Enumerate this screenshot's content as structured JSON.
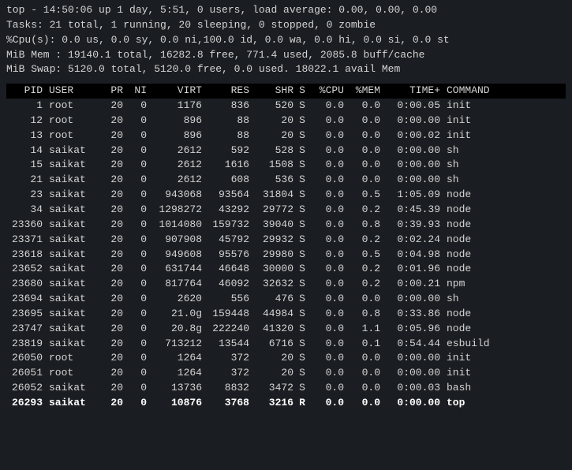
{
  "summary": {
    "line1": "top - 14:50:06 up 1 day,  5:51,  0 users,  load average: 0.00, 0.00, 0.00",
    "line2": "Tasks:  21 total,   1 running,  20 sleeping,   0 stopped,   0 zombie",
    "line3": "%Cpu(s):  0.0 us,  0.0 sy,  0.0 ni,100.0 id,  0.0 wa,  0.0 hi,  0.0 si,  0.0 st",
    "line4": "MiB Mem :  19140.1 total,  16282.8 free,    771.4 used,   2085.8 buff/cache",
    "line5": "MiB Swap:   5120.0 total,   5120.0 free,      0.0 used.  18022.1 avail Mem"
  },
  "headers": {
    "pid": "PID",
    "user": "USER",
    "pr": "PR",
    "ni": "NI",
    "virt": "VIRT",
    "res": "RES",
    "shr": "SHR",
    "s": "S",
    "cpu": "%CPU",
    "mem": "%MEM",
    "time": "TIME+",
    "command": "COMMAND"
  },
  "processes": [
    {
      "pid": "1",
      "user": "root",
      "pr": "20",
      "ni": "0",
      "virt": "1176",
      "res": "836",
      "shr": "520",
      "s": "S",
      "cpu": "0.0",
      "mem": "0.0",
      "time": "0:00.05",
      "command": "init",
      "running": false
    },
    {
      "pid": "12",
      "user": "root",
      "pr": "20",
      "ni": "0",
      "virt": "896",
      "res": "88",
      "shr": "20",
      "s": "S",
      "cpu": "0.0",
      "mem": "0.0",
      "time": "0:00.00",
      "command": "init",
      "running": false
    },
    {
      "pid": "13",
      "user": "root",
      "pr": "20",
      "ni": "0",
      "virt": "896",
      "res": "88",
      "shr": "20",
      "s": "S",
      "cpu": "0.0",
      "mem": "0.0",
      "time": "0:00.02",
      "command": "init",
      "running": false
    },
    {
      "pid": "14",
      "user": "saikat",
      "pr": "20",
      "ni": "0",
      "virt": "2612",
      "res": "592",
      "shr": "528",
      "s": "S",
      "cpu": "0.0",
      "mem": "0.0",
      "time": "0:00.00",
      "command": "sh",
      "running": false
    },
    {
      "pid": "15",
      "user": "saikat",
      "pr": "20",
      "ni": "0",
      "virt": "2612",
      "res": "1616",
      "shr": "1508",
      "s": "S",
      "cpu": "0.0",
      "mem": "0.0",
      "time": "0:00.00",
      "command": "sh",
      "running": false
    },
    {
      "pid": "21",
      "user": "saikat",
      "pr": "20",
      "ni": "0",
      "virt": "2612",
      "res": "608",
      "shr": "536",
      "s": "S",
      "cpu": "0.0",
      "mem": "0.0",
      "time": "0:00.00",
      "command": "sh",
      "running": false
    },
    {
      "pid": "23",
      "user": "saikat",
      "pr": "20",
      "ni": "0",
      "virt": "943068",
      "res": "93564",
      "shr": "31804",
      "s": "S",
      "cpu": "0.0",
      "mem": "0.5",
      "time": "1:05.09",
      "command": "node",
      "running": false
    },
    {
      "pid": "34",
      "user": "saikat",
      "pr": "20",
      "ni": "0",
      "virt": "1298272",
      "res": "43292",
      "shr": "29772",
      "s": "S",
      "cpu": "0.0",
      "mem": "0.2",
      "time": "0:45.39",
      "command": "node",
      "running": false
    },
    {
      "pid": "23360",
      "user": "saikat",
      "pr": "20",
      "ni": "0",
      "virt": "1014080",
      "res": "159732",
      "shr": "39040",
      "s": "S",
      "cpu": "0.0",
      "mem": "0.8",
      "time": "0:39.93",
      "command": "node",
      "running": false
    },
    {
      "pid": "23371",
      "user": "saikat",
      "pr": "20",
      "ni": "0",
      "virt": "907908",
      "res": "45792",
      "shr": "29932",
      "s": "S",
      "cpu": "0.0",
      "mem": "0.2",
      "time": "0:02.24",
      "command": "node",
      "running": false
    },
    {
      "pid": "23618",
      "user": "saikat",
      "pr": "20",
      "ni": "0",
      "virt": "949608",
      "res": "95576",
      "shr": "29980",
      "s": "S",
      "cpu": "0.0",
      "mem": "0.5",
      "time": "0:04.98",
      "command": "node",
      "running": false
    },
    {
      "pid": "23652",
      "user": "saikat",
      "pr": "20",
      "ni": "0",
      "virt": "631744",
      "res": "46648",
      "shr": "30000",
      "s": "S",
      "cpu": "0.0",
      "mem": "0.2",
      "time": "0:01.96",
      "command": "node",
      "running": false
    },
    {
      "pid": "23680",
      "user": "saikat",
      "pr": "20",
      "ni": "0",
      "virt": "817764",
      "res": "46092",
      "shr": "32632",
      "s": "S",
      "cpu": "0.0",
      "mem": "0.2",
      "time": "0:00.21",
      "command": "npm",
      "running": false
    },
    {
      "pid": "23694",
      "user": "saikat",
      "pr": "20",
      "ni": "0",
      "virt": "2620",
      "res": "556",
      "shr": "476",
      "s": "S",
      "cpu": "0.0",
      "mem": "0.0",
      "time": "0:00.00",
      "command": "sh",
      "running": false
    },
    {
      "pid": "23695",
      "user": "saikat",
      "pr": "20",
      "ni": "0",
      "virt": "21.0g",
      "res": "159448",
      "shr": "44984",
      "s": "S",
      "cpu": "0.0",
      "mem": "0.8",
      "time": "0:33.86",
      "command": "node",
      "running": false
    },
    {
      "pid": "23747",
      "user": "saikat",
      "pr": "20",
      "ni": "0",
      "virt": "20.8g",
      "res": "222240",
      "shr": "41320",
      "s": "S",
      "cpu": "0.0",
      "mem": "1.1",
      "time": "0:05.96",
      "command": "node",
      "running": false
    },
    {
      "pid": "23819",
      "user": "saikat",
      "pr": "20",
      "ni": "0",
      "virt": "713212",
      "res": "13544",
      "shr": "6716",
      "s": "S",
      "cpu": "0.0",
      "mem": "0.1",
      "time": "0:54.44",
      "command": "esbuild",
      "running": false
    },
    {
      "pid": "26050",
      "user": "root",
      "pr": "20",
      "ni": "0",
      "virt": "1264",
      "res": "372",
      "shr": "20",
      "s": "S",
      "cpu": "0.0",
      "mem": "0.0",
      "time": "0:00.00",
      "command": "init",
      "running": false
    },
    {
      "pid": "26051",
      "user": "root",
      "pr": "20",
      "ni": "0",
      "virt": "1264",
      "res": "372",
      "shr": "20",
      "s": "S",
      "cpu": "0.0",
      "mem": "0.0",
      "time": "0:00.00",
      "command": "init",
      "running": false
    },
    {
      "pid": "26052",
      "user": "saikat",
      "pr": "20",
      "ni": "0",
      "virt": "13736",
      "res": "8832",
      "shr": "3472",
      "s": "S",
      "cpu": "0.0",
      "mem": "0.0",
      "time": "0:00.03",
      "command": "bash",
      "running": false
    },
    {
      "pid": "26293",
      "user": "saikat",
      "pr": "20",
      "ni": "0",
      "virt": "10876",
      "res": "3768",
      "shr": "3216",
      "s": "R",
      "cpu": "0.0",
      "mem": "0.0",
      "time": "0:00.00",
      "command": "top",
      "running": true
    }
  ]
}
